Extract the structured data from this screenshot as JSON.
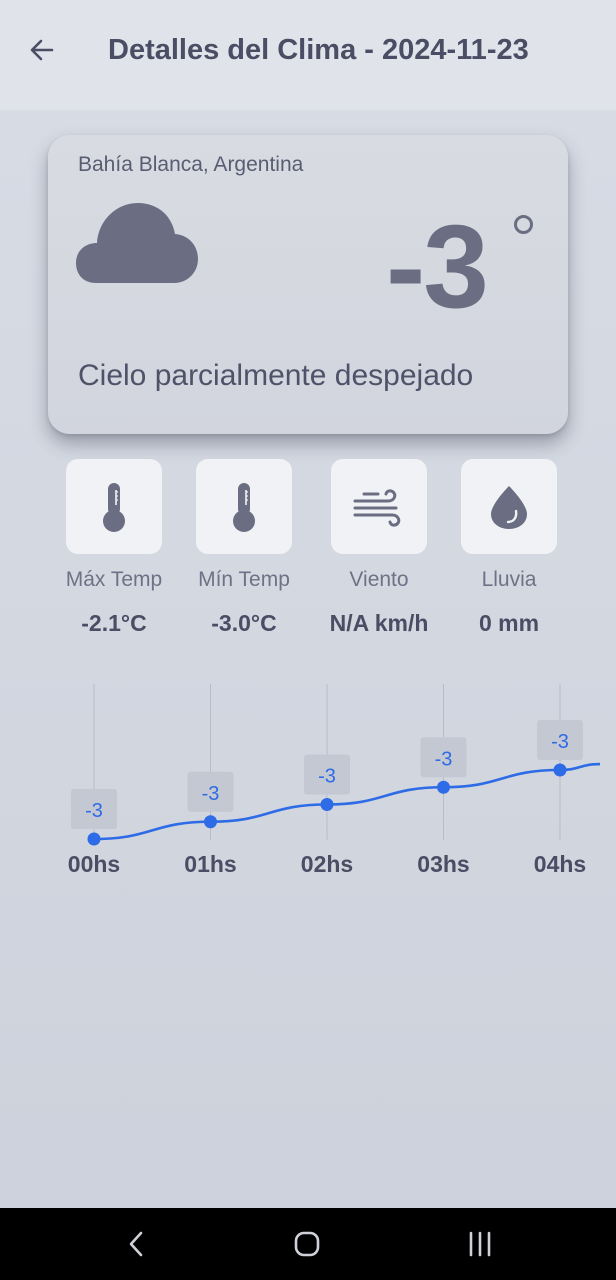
{
  "header": {
    "title": "Detalles del Clima - 2024-11-23",
    "back_icon": "arrow-left-icon"
  },
  "current": {
    "location": "Bahía Blanca, Argentina",
    "temperature": "-3",
    "icon": "cloud-icon",
    "condition": "Cielo parcialmente despejado"
  },
  "stats": [
    {
      "label": "Máx Temp",
      "value": "-2.1°C",
      "icon": "thermometer-icon"
    },
    {
      "label": "Mín Temp",
      "value": "-3.0°C",
      "icon": "thermometer-icon"
    },
    {
      "label": "Viento",
      "value": "N/A km/h",
      "icon": "wind-icon"
    },
    {
      "label": "Lluvia",
      "value": "0 mm",
      "icon": "water-drop-icon"
    }
  ],
  "chart_data": {
    "type": "line",
    "categories": [
      "00hs",
      "01hs",
      "02hs",
      "03hs",
      "04hs"
    ],
    "series": [
      {
        "values": [
          -3.0,
          -2.9,
          -2.8,
          -2.7,
          -2.6
        ],
        "labels": [
          "-3",
          "-3",
          "-3",
          "-3",
          "-3"
        ]
      }
    ],
    "line_color": "#2e6be6",
    "grid": "vertical"
  },
  "navbar": {
    "back_icon": "nav-back-icon",
    "home_icon": "nav-home-icon",
    "recents_icon": "nav-recents-icon"
  }
}
